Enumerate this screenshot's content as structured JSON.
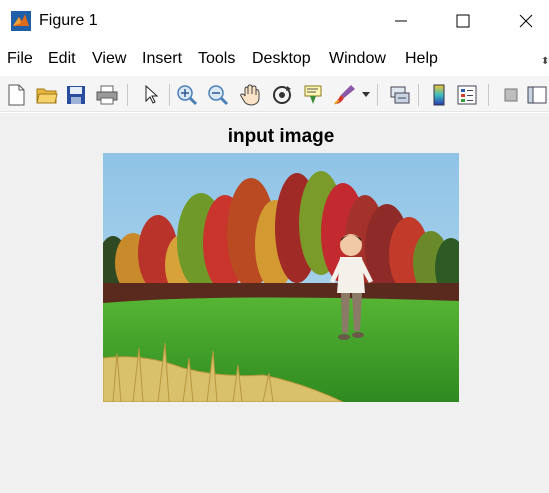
{
  "window": {
    "title": "Figure 1",
    "minimize_glyph": "—",
    "maximize_glyph": "☐",
    "close_glyph": "✕"
  },
  "menu": {
    "items": [
      {
        "label": "File"
      },
      {
        "label": "Edit"
      },
      {
        "label": "View"
      },
      {
        "label": "Insert"
      },
      {
        "label": "Tools"
      },
      {
        "label": "Desktop"
      },
      {
        "label": "Window"
      },
      {
        "label": "Help"
      }
    ]
  },
  "toolbar": {
    "icons": [
      "new-figure-icon",
      "open-file-icon",
      "save-icon",
      "print-icon",
      "pointer-icon",
      "zoom-in-icon",
      "zoom-out-icon",
      "pan-icon",
      "rotate-3d-icon",
      "data-cursor-icon",
      "brush-icon",
      "link-plot-icon",
      "insert-colorbar-icon",
      "insert-legend-icon",
      "hide-plot-tools-icon",
      "show-plot-tools-icon"
    ]
  },
  "axes": {
    "title": "input image"
  },
  "colors": {
    "window_bg": "#ffffff",
    "figure_bg": "#f0f0f0",
    "toolbar_bg": "#f5f5f5",
    "sky": "#8fc3e6",
    "grass": "#3f9a2a"
  }
}
